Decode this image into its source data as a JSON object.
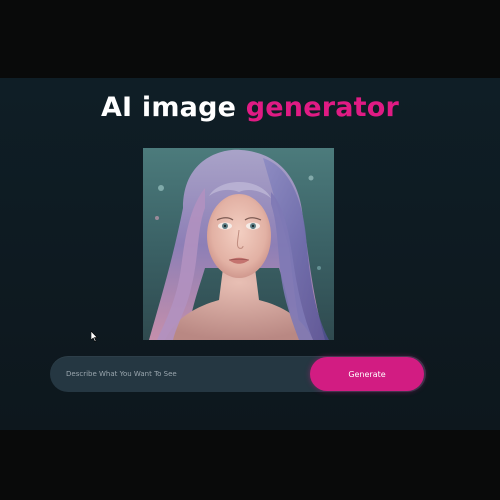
{
  "header": {
    "title_main": "AI image",
    "title_accent": "generator"
  },
  "preview": {
    "image_icon": "generated-portrait-image"
  },
  "prompt": {
    "placeholder": "Describe What You Want To See",
    "value": ""
  },
  "actions": {
    "generate_label": "Generate"
  },
  "colors": {
    "accent": "#e01b84",
    "button": "#d21c82",
    "background": "#0e1a21",
    "input_bg": "#253742",
    "title": "#ffffff"
  }
}
